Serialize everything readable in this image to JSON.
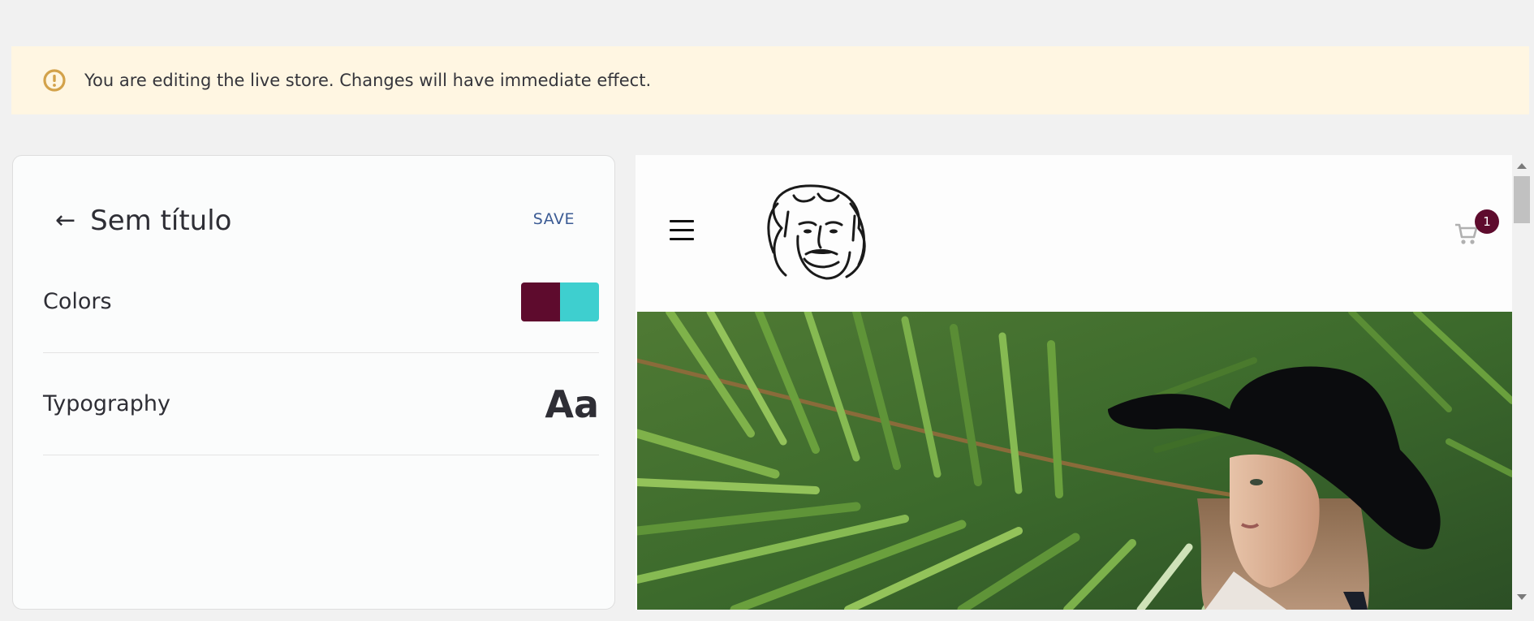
{
  "banner": {
    "message": "You are editing the live store. Changes will have immediate effect.",
    "icon": "alert-circle-icon",
    "icon_color": "#d3a24a",
    "background": "#fff6e2"
  },
  "editor": {
    "back_icon": "arrow-left-icon",
    "title": "Sem título",
    "save_label": "SAVE",
    "rows": [
      {
        "label": "Colors",
        "swatch_colors": [
          "#5e0b2d",
          "#3ecfcf"
        ]
      },
      {
        "label": "Typography",
        "sample": "Aa"
      }
    ]
  },
  "preview": {
    "menu_icon": "hamburger-menu-icon",
    "logo": "store-logo-face-sketch",
    "cart_icon": "shopping-cart-icon",
    "cart_count": "1",
    "cart_badge_color": "#5e0b2d",
    "hero": "woman-in-black-hat-with-palm-leaves"
  }
}
